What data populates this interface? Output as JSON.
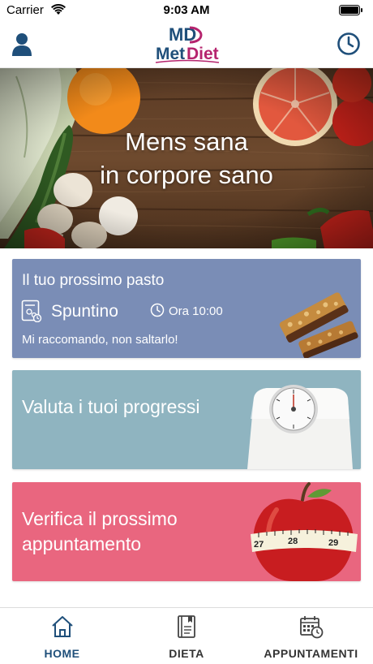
{
  "status_bar": {
    "carrier": "Carrier",
    "time": "9:03 AM"
  },
  "header": {
    "logo_monogram": "MD",
    "logo_text_met": "Met",
    "logo_text_diet": "Diet",
    "left_icon": "user-icon",
    "right_icon": "clock-icon"
  },
  "hero": {
    "line1": "Mens sana",
    "line2": "in corpore sano"
  },
  "next_meal": {
    "heading": "Il tuo prossimo pasto",
    "meal_icon": "meal-plan-icon",
    "meal_name": "Spuntino",
    "time_icon": "clock-icon",
    "time_label": "Ora 10:00",
    "note": "Mi raccomando, non saltarlo!"
  },
  "progress_card": {
    "title": "Valuta i tuoi progressi"
  },
  "appointment_card": {
    "title": "Verifica il prossimo appuntamento"
  },
  "tab_bar": {
    "tabs": [
      {
        "label": "HOME",
        "icon": "home-icon",
        "active": true
      },
      {
        "label": "DIETA",
        "icon": "diet-book-icon",
        "active": false
      },
      {
        "label": "APPUNTAMENTI",
        "icon": "calendar-clock-icon",
        "active": false
      }
    ]
  },
  "colors": {
    "primary_navy": "#1f4f7a",
    "meal_card": "#7a8db6",
    "progress_card": "#8fb4c0",
    "appointment_card": "#e9667f",
    "logo_magenta": "#b5246e"
  }
}
